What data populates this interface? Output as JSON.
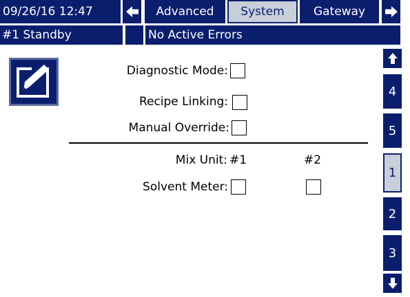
{
  "header": {
    "datetime": "09/26/16 12:47",
    "tabs": [
      {
        "label": "Advanced",
        "active": false
      },
      {
        "label": "System",
        "active": true
      },
      {
        "label": "Gateway",
        "active": false
      }
    ],
    "status": "#1 Standby",
    "errors": "No Active Errors"
  },
  "form": {
    "diagnostic_mode": {
      "label": "Diagnostic Mode:",
      "checked": false
    },
    "recipe_linking": {
      "label": "Recipe Linking:",
      "checked": false
    },
    "manual_override": {
      "label": "Manual Override:",
      "checked": false
    },
    "mix_unit_label": "Mix Unit:",
    "unit1": "#1",
    "unit2": "#2",
    "solvent_meter": {
      "label": "Solvent Meter:",
      "unit1_checked": false,
      "unit2_checked": false
    }
  },
  "side_pages": [
    "4",
    "5",
    "1",
    "2",
    "3"
  ],
  "active_side_page": "1",
  "icons": {
    "edit": "edit-icon",
    "left": "arrow-left-icon",
    "right": "arrow-right-icon",
    "up": "arrow-up-icon",
    "down": "arrow-down-icon"
  },
  "colors": {
    "navy": "#0b1e6e",
    "active_tab": "#c9cfd9",
    "background": "#ffffff"
  }
}
